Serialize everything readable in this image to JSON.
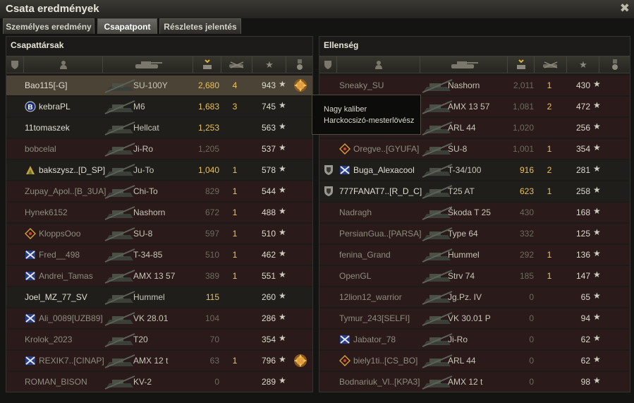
{
  "window": {
    "title": "Csata eredmények"
  },
  "tabs": [
    {
      "label": "Személyes eredmény",
      "active": false
    },
    {
      "label": "Csapatpont",
      "active": true
    },
    {
      "label": "Részletes jelentés",
      "active": false
    }
  ],
  "allies": {
    "title": "Csapattársak",
    "rows": [
      {
        "name": "Bao115[-G]",
        "tank": "SU-100Y",
        "damage": "2,680",
        "frags": "4",
        "xp": "943",
        "badge": "",
        "medal": true,
        "highlight": "self",
        "dead": false
      },
      {
        "name": "kebraPL",
        "tank": "M6",
        "damage": "1,683",
        "frags": "3",
        "xp": "745",
        "badge": "clan-b",
        "medal": false,
        "highlight": "",
        "dead": false
      },
      {
        "name": "11tomaszek",
        "tank": "Hellcat",
        "damage": "1,253",
        "frags": "",
        "xp": "563",
        "badge": "",
        "medal": false,
        "highlight": "",
        "dead": false
      },
      {
        "name": "bobcelal",
        "tank": "Ji-Ro",
        "damage": "1,205",
        "frags": "",
        "xp": "537",
        "badge": "",
        "medal": false,
        "highlight": "",
        "dead": true
      },
      {
        "name": "bakszysz..[D_SP]",
        "tank": "Ju-To",
        "damage": "1,040",
        "frags": "1",
        "xp": "578",
        "badge": "clan-gold",
        "medal": false,
        "highlight": "",
        "dead": false
      },
      {
        "name": "Zupay_Apol..[B_3UA]",
        "tank": "Chi-To",
        "damage": "829",
        "frags": "1",
        "xp": "544",
        "badge": "",
        "medal": false,
        "highlight": "",
        "dead": true
      },
      {
        "name": "Hynek6152",
        "tank": "Nashorn",
        "damage": "672",
        "frags": "1",
        "xp": "488",
        "badge": "",
        "medal": false,
        "highlight": "",
        "dead": true
      },
      {
        "name": "KloppsOoo",
        "tank": "SU-8",
        "damage": "597",
        "frags": "1",
        "xp": "510",
        "badge": "clan-diamond",
        "medal": false,
        "highlight": "",
        "dead": true
      },
      {
        "name": "Fred__498",
        "tank": "T-34-85",
        "damage": "510",
        "frags": "1",
        "xp": "462",
        "badge": "clan-blue",
        "medal": false,
        "highlight": "",
        "dead": true
      },
      {
        "name": "Andrei_Tamas",
        "tank": "AMX 13 57",
        "damage": "389",
        "frags": "1",
        "xp": "551",
        "badge": "clan-blue",
        "medal": false,
        "highlight": "",
        "dead": true
      },
      {
        "name": "Joel_MZ_77_SV",
        "tank": "Hummel",
        "damage": "115",
        "frags": "",
        "xp": "260",
        "badge": "",
        "medal": false,
        "highlight": "",
        "dead": false
      },
      {
        "name": "Ali_0089[UZB89]",
        "tank": "VK 28.01",
        "damage": "104",
        "frags": "",
        "xp": "286",
        "badge": "clan-blue",
        "medal": false,
        "highlight": "",
        "dead": true
      },
      {
        "name": "Krolok_2023",
        "tank": "T20",
        "damage": "70",
        "frags": "",
        "xp": "354",
        "badge": "",
        "medal": false,
        "highlight": "",
        "dead": true
      },
      {
        "name": "REXIK7..[CINAP]",
        "tank": "AMX 12 t",
        "damage": "63",
        "frags": "1",
        "xp": "796",
        "badge": "clan-blue",
        "medal": true,
        "highlight": "",
        "dead": true
      },
      {
        "name": "ROMAN_BISON",
        "tank": "KV-2",
        "damage": "0",
        "frags": "",
        "xp": "289",
        "badge": "",
        "medal": false,
        "highlight": "",
        "dead": true
      }
    ]
  },
  "enemies": {
    "title": "Ellenség",
    "rows": [
      {
        "name": "Sneaky_SU",
        "tank": "Nashorn",
        "damage": "2,011",
        "frags": "1",
        "xp": "430",
        "badge": "",
        "dead": true
      },
      {
        "name": "",
        "tank": "AMX 13 57",
        "damage": "1,081",
        "frags": "2",
        "xp": "472",
        "badge": "",
        "dead": true
      },
      {
        "name": "",
        "tank": "ARL 44",
        "damage": "1,020",
        "frags": "",
        "xp": "256",
        "badge": "",
        "dead": true
      },
      {
        "name": "Oregve..[GYUFA]",
        "tank": "SU-8",
        "damage": "1,001",
        "frags": "1",
        "xp": "354",
        "badge": "clan-diamond",
        "dead": true
      },
      {
        "name": "Buga_Alexacool",
        "tank": "T-34/100",
        "damage": "916",
        "frags": "2",
        "xp": "281",
        "badge": "clan-blue",
        "shield": true,
        "dead": false
      },
      {
        "name": "777FANAT7..[R_D_C]",
        "tank": "T25 AT",
        "damage": "623",
        "frags": "1",
        "xp": "258",
        "badge": "",
        "shield": true,
        "dead": false
      },
      {
        "name": "Nadragh",
        "tank": "Škoda T 25",
        "damage": "430",
        "frags": "",
        "xp": "168",
        "badge": "",
        "dead": true
      },
      {
        "name": "PersianGua..[PARSA]",
        "tank": "Type 64",
        "damage": "332",
        "frags": "",
        "xp": "125",
        "badge": "",
        "dead": true
      },
      {
        "name": "fenina_Grand",
        "tank": "Hummel",
        "damage": "292",
        "frags": "1",
        "xp": "136",
        "badge": "",
        "dead": true
      },
      {
        "name": "OpenGL",
        "tank": "Strv 74",
        "damage": "185",
        "frags": "1",
        "xp": "147",
        "badge": "",
        "dead": true
      },
      {
        "name": "12lion12_warrior",
        "tank": "Jg.Pz. IV",
        "damage": "0",
        "frags": "",
        "xp": "65",
        "badge": "",
        "dead": true
      },
      {
        "name": "Tymur_243[SELFI]",
        "tank": "VK 30.01 P",
        "damage": "0",
        "frags": "",
        "xp": "94",
        "badge": "",
        "dead": true
      },
      {
        "name": "Jabator_78",
        "tank": "Ji-Ro",
        "damage": "0",
        "frags": "",
        "xp": "62",
        "badge": "clan-blue",
        "dead": true
      },
      {
        "name": "biely1ti..[CS_BO]",
        "tank": "ARL 44",
        "damage": "0",
        "frags": "",
        "xp": "62",
        "badge": "clan-diamond",
        "dead": true
      },
      {
        "name": "Bodnariuk_Vl..[KPA3]",
        "tank": "AMX 12 t",
        "damage": "0",
        "frags": "",
        "xp": "98",
        "badge": "",
        "dead": true
      }
    ]
  },
  "tooltip": {
    "line1": "Nagy kaliber",
    "line2": "Harckocsizó-mesterlövész"
  },
  "star_glyph": "★",
  "colors": {
    "gold": "#f0c45a",
    "dead_row": "#2a1a19",
    "alive_row": "#1f1e1b",
    "self_row": "#4a4336"
  }
}
